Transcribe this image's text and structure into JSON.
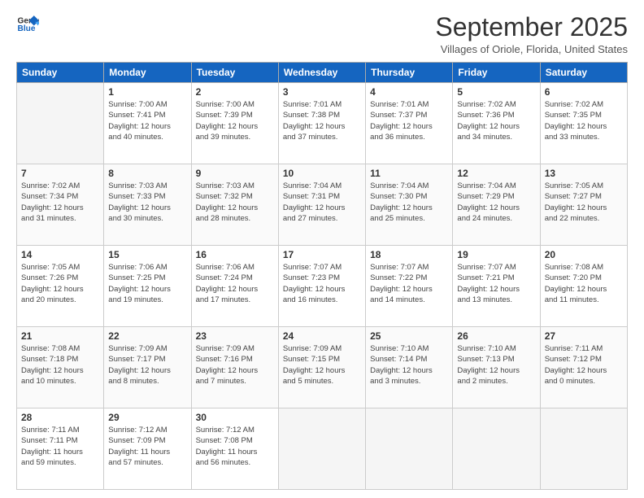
{
  "logo": {
    "line1": "General",
    "line2": "Blue"
  },
  "title": "September 2025",
  "subtitle": "Villages of Oriole, Florida, United States",
  "days": [
    "Sunday",
    "Monday",
    "Tuesday",
    "Wednesday",
    "Thursday",
    "Friday",
    "Saturday"
  ],
  "weeks": [
    [
      {
        "day": "",
        "info": ""
      },
      {
        "day": "1",
        "info": "Sunrise: 7:00 AM\nSunset: 7:41 PM\nDaylight: 12 hours\nand 40 minutes."
      },
      {
        "day": "2",
        "info": "Sunrise: 7:00 AM\nSunset: 7:39 PM\nDaylight: 12 hours\nand 39 minutes."
      },
      {
        "day": "3",
        "info": "Sunrise: 7:01 AM\nSunset: 7:38 PM\nDaylight: 12 hours\nand 37 minutes."
      },
      {
        "day": "4",
        "info": "Sunrise: 7:01 AM\nSunset: 7:37 PM\nDaylight: 12 hours\nand 36 minutes."
      },
      {
        "day": "5",
        "info": "Sunrise: 7:02 AM\nSunset: 7:36 PM\nDaylight: 12 hours\nand 34 minutes."
      },
      {
        "day": "6",
        "info": "Sunrise: 7:02 AM\nSunset: 7:35 PM\nDaylight: 12 hours\nand 33 minutes."
      }
    ],
    [
      {
        "day": "7",
        "info": "Sunrise: 7:02 AM\nSunset: 7:34 PM\nDaylight: 12 hours\nand 31 minutes."
      },
      {
        "day": "8",
        "info": "Sunrise: 7:03 AM\nSunset: 7:33 PM\nDaylight: 12 hours\nand 30 minutes."
      },
      {
        "day": "9",
        "info": "Sunrise: 7:03 AM\nSunset: 7:32 PM\nDaylight: 12 hours\nand 28 minutes."
      },
      {
        "day": "10",
        "info": "Sunrise: 7:04 AM\nSunset: 7:31 PM\nDaylight: 12 hours\nand 27 minutes."
      },
      {
        "day": "11",
        "info": "Sunrise: 7:04 AM\nSunset: 7:30 PM\nDaylight: 12 hours\nand 25 minutes."
      },
      {
        "day": "12",
        "info": "Sunrise: 7:04 AM\nSunset: 7:29 PM\nDaylight: 12 hours\nand 24 minutes."
      },
      {
        "day": "13",
        "info": "Sunrise: 7:05 AM\nSunset: 7:27 PM\nDaylight: 12 hours\nand 22 minutes."
      }
    ],
    [
      {
        "day": "14",
        "info": "Sunrise: 7:05 AM\nSunset: 7:26 PM\nDaylight: 12 hours\nand 20 minutes."
      },
      {
        "day": "15",
        "info": "Sunrise: 7:06 AM\nSunset: 7:25 PM\nDaylight: 12 hours\nand 19 minutes."
      },
      {
        "day": "16",
        "info": "Sunrise: 7:06 AM\nSunset: 7:24 PM\nDaylight: 12 hours\nand 17 minutes."
      },
      {
        "day": "17",
        "info": "Sunrise: 7:07 AM\nSunset: 7:23 PM\nDaylight: 12 hours\nand 16 minutes."
      },
      {
        "day": "18",
        "info": "Sunrise: 7:07 AM\nSunset: 7:22 PM\nDaylight: 12 hours\nand 14 minutes."
      },
      {
        "day": "19",
        "info": "Sunrise: 7:07 AM\nSunset: 7:21 PM\nDaylight: 12 hours\nand 13 minutes."
      },
      {
        "day": "20",
        "info": "Sunrise: 7:08 AM\nSunset: 7:20 PM\nDaylight: 12 hours\nand 11 minutes."
      }
    ],
    [
      {
        "day": "21",
        "info": "Sunrise: 7:08 AM\nSunset: 7:18 PM\nDaylight: 12 hours\nand 10 minutes."
      },
      {
        "day": "22",
        "info": "Sunrise: 7:09 AM\nSunset: 7:17 PM\nDaylight: 12 hours\nand 8 minutes."
      },
      {
        "day": "23",
        "info": "Sunrise: 7:09 AM\nSunset: 7:16 PM\nDaylight: 12 hours\nand 7 minutes."
      },
      {
        "day": "24",
        "info": "Sunrise: 7:09 AM\nSunset: 7:15 PM\nDaylight: 12 hours\nand 5 minutes."
      },
      {
        "day": "25",
        "info": "Sunrise: 7:10 AM\nSunset: 7:14 PM\nDaylight: 12 hours\nand 3 minutes."
      },
      {
        "day": "26",
        "info": "Sunrise: 7:10 AM\nSunset: 7:13 PM\nDaylight: 12 hours\nand 2 minutes."
      },
      {
        "day": "27",
        "info": "Sunrise: 7:11 AM\nSunset: 7:12 PM\nDaylight: 12 hours\nand 0 minutes."
      }
    ],
    [
      {
        "day": "28",
        "info": "Sunrise: 7:11 AM\nSunset: 7:11 PM\nDaylight: 11 hours\nand 59 minutes."
      },
      {
        "day": "29",
        "info": "Sunrise: 7:12 AM\nSunset: 7:09 PM\nDaylight: 11 hours\nand 57 minutes."
      },
      {
        "day": "30",
        "info": "Sunrise: 7:12 AM\nSunset: 7:08 PM\nDaylight: 11 hours\nand 56 minutes."
      },
      {
        "day": "",
        "info": ""
      },
      {
        "day": "",
        "info": ""
      },
      {
        "day": "",
        "info": ""
      },
      {
        "day": "",
        "info": ""
      }
    ]
  ]
}
